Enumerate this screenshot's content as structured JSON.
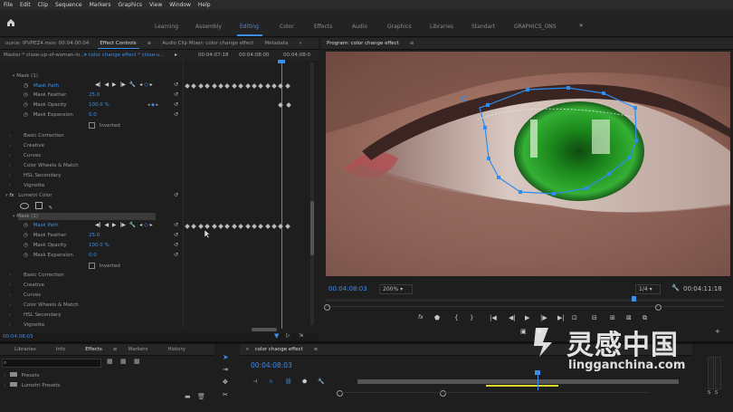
{
  "menu": [
    "File",
    "Edit",
    "Clip",
    "Sequence",
    "Markers",
    "Graphics",
    "View",
    "Window",
    "Help"
  ],
  "workspaces": [
    {
      "label": "Learning",
      "active": false
    },
    {
      "label": "Assembly",
      "active": false
    },
    {
      "label": "Editing",
      "active": true
    },
    {
      "label": "Color",
      "active": false
    },
    {
      "label": "Effects",
      "active": false
    },
    {
      "label": "Audio",
      "active": false
    },
    {
      "label": "Graphics",
      "active": false
    },
    {
      "label": "Libraries",
      "active": false
    },
    {
      "label": "Standart",
      "active": false
    },
    {
      "label": "GRAPHICS_ONS",
      "active": false
    }
  ],
  "effect_controls": {
    "tabs": [
      "ource: IPVPEZ4.mov: 00:04:00:04",
      "Effect Controls",
      "Audio Clip Mixer: color change effect",
      "Metadata"
    ],
    "master_label": "Master * close-up-of-woman-in...",
    "clip_label": "color change effect * close-u...",
    "times": [
      "00:04:07:18",
      "00:04:08:00",
      "00:04:08:0"
    ],
    "mask1": {
      "title": "Mask (1)",
      "path": "Mask Path",
      "feather_label": "Mask Feather",
      "feather_value": "25.0",
      "opacity_label": "Mask Opacity",
      "opacity_value": "100.0 %",
      "expansion_label": "Mask Expansion",
      "expansion_value": "0.0",
      "inverted_label": "Inverted"
    },
    "sections1": [
      "Basic Correction",
      "Creative",
      "Curves",
      "Color Wheels & Match",
      "HSL Secondary",
      "Vignette"
    ],
    "fx_label": "Lumetri Color",
    "mask2": {
      "title": "Mask (1)",
      "path": "Mask Path",
      "feather_label": "Mask Feather",
      "feather_value": "25.0",
      "opacity_label": "Mask Opacity",
      "opacity_value": "100.0 %",
      "expansion_label": "Mask Expansion",
      "expansion_value": "0.0",
      "inverted_label": "Inverted"
    },
    "sections2": [
      "Basic Correction",
      "Creative",
      "Curves",
      "Color Wheels & Match",
      "HSL Secondary",
      "Vignette"
    ],
    "current_time": "00:04:08:03"
  },
  "program": {
    "title": "Program: color change effect",
    "timecode": "00:04:08:03",
    "zoom": "200%",
    "resolution": "1/4",
    "duration": "00:04:11:18"
  },
  "bottom_left": {
    "tabs": [
      "Libraries",
      "Info",
      "Effects",
      "Markers",
      "History"
    ],
    "items": [
      "Presets",
      "Lumetri Presets"
    ]
  },
  "timeline": {
    "title": "color change effect",
    "timecode": "00:04:08:03"
  },
  "audio_meter": {
    "labels": [
      "S",
      "S"
    ]
  },
  "watermark": {
    "cn": "灵感中国",
    "url": "lingganchina.com"
  },
  "colors": {
    "accent": "#3d8ee8",
    "panel": "#1e1e1e",
    "mask": "#2e8df0",
    "iris": "#1fa31f"
  }
}
